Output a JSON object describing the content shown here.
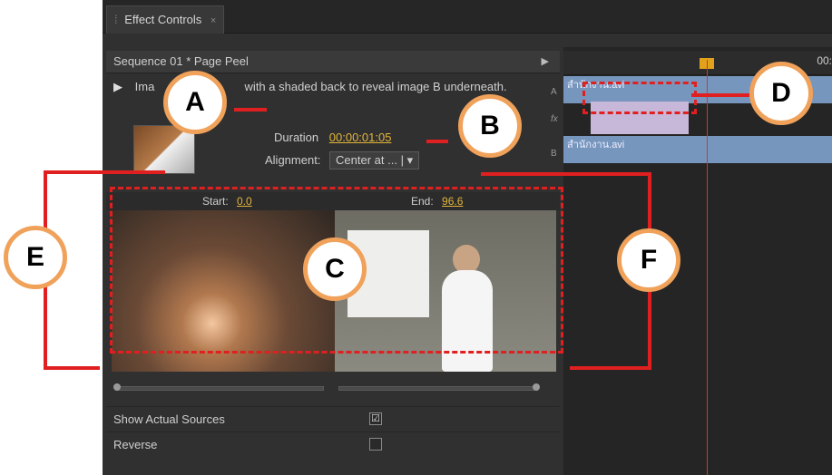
{
  "tab": {
    "title": "Effect Controls",
    "close": "×"
  },
  "sequence": {
    "title": "Sequence 01 * Page Peel"
  },
  "description": {
    "text_start": "Ima",
    "text_mid": "with a shaded back to reveal image B underneath."
  },
  "duration": {
    "label": "Duration",
    "value": "00:00:01:05"
  },
  "alignment": {
    "label": "Alignment:",
    "value": "Center at ..."
  },
  "start": {
    "label": "Start:",
    "value": "0.0"
  },
  "end": {
    "label": "End:",
    "value": "96.6"
  },
  "options": [
    {
      "label": "Show Actual Sources",
      "checked": true,
      "mark": "☑"
    },
    {
      "label": "Reverse",
      "checked": false,
      "mark": ""
    }
  ],
  "timeline": {
    "timecode": "00:",
    "clip_a": "สำนักงาน.avi",
    "clip_b": "สำนักงาน.avi",
    "track_a": "A",
    "track_b": "B",
    "fx": "fx"
  },
  "annotations": [
    "A",
    "B",
    "C",
    "D",
    "E",
    "F"
  ],
  "colors": {
    "accent": "#e3b53b",
    "annotation_red": "#e02020",
    "bubble_border": "#f0a15a"
  }
}
